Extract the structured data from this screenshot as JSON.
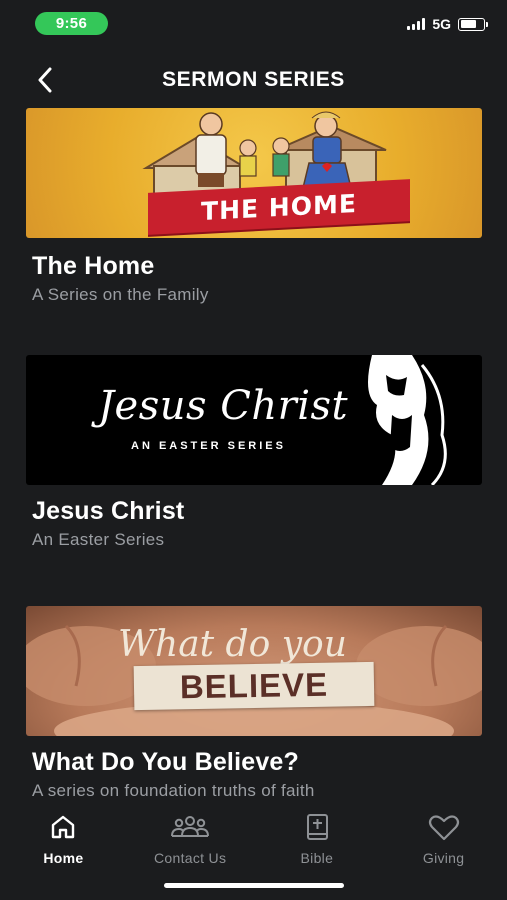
{
  "status_bar": {
    "time": "9:56",
    "network": "5G"
  },
  "header": {
    "title": "SERMON SERIES"
  },
  "series": [
    {
      "title": "The Home",
      "subtitle": "A Series on the Family",
      "banner_text": "THE HOME"
    },
    {
      "title": "Jesus Christ",
      "subtitle": "An Easter Series",
      "banner_script": "Jesus Christ",
      "banner_tag": "AN EASTER SERIES"
    },
    {
      "title": "What Do You Believe?",
      "subtitle": "A series on foundation truths of faith",
      "banner_script": "What do you",
      "banner_word": "BELIEVE"
    }
  ],
  "tabs": [
    {
      "label": "Home",
      "icon": "home-icon",
      "active": true
    },
    {
      "label": "Contact Us",
      "icon": "people-icon",
      "active": false
    },
    {
      "label": "Bible",
      "icon": "bible-icon",
      "active": false
    },
    {
      "label": "Giving",
      "icon": "heart-icon",
      "active": false
    }
  ],
  "colors": {
    "background": "#1b1c1e",
    "time_pill": "#34c759",
    "subtitle": "#9b9ea3",
    "tab_inactive": "#8e9195"
  }
}
